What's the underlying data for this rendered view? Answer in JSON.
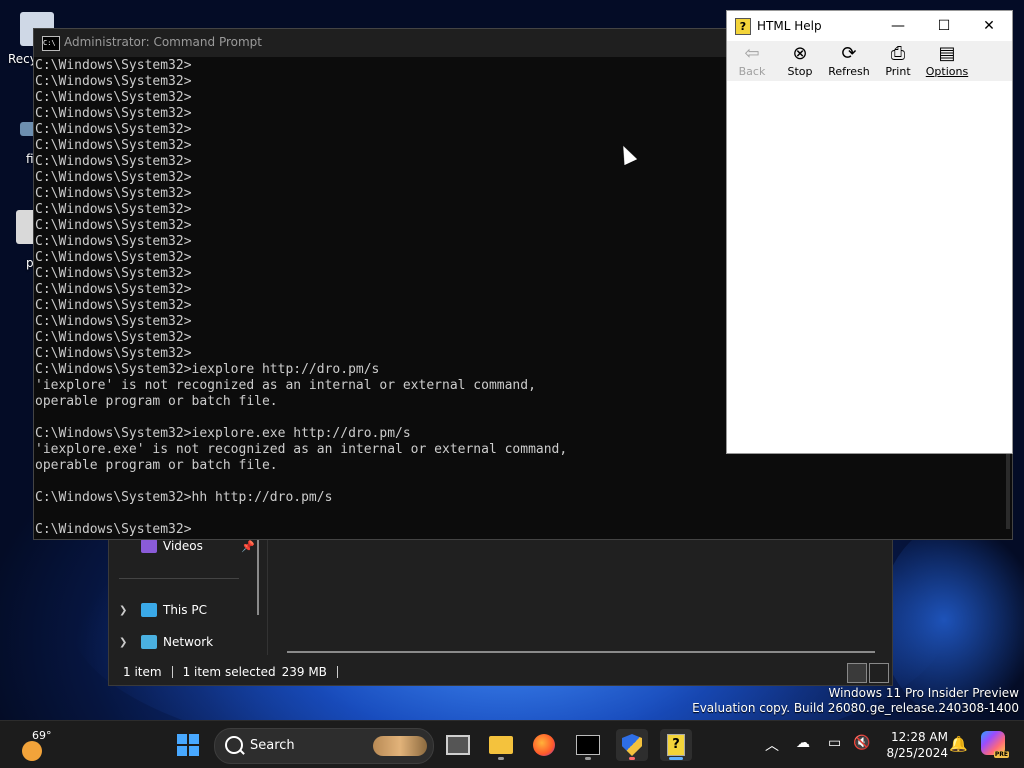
{
  "desktop": {
    "icons": [
      {
        "label": "Recy",
        "color": "#cfd8e6"
      },
      {
        "label": "fi",
        "color": "#6d8fb0"
      },
      {
        "label": "p",
        "color": "#d9d9d9"
      }
    ],
    "watermark_line1": "Windows 11 Pro Insider Preview",
    "watermark_line2": "Evaluation copy. Build 26080.ge_release.240308-1400"
  },
  "explorer": {
    "nav_items": [
      {
        "label": "Videos",
        "icon": "videos-icon",
        "color": "#8a5bd8"
      },
      {
        "label": "This PC",
        "icon": "pc-icon",
        "color": "#3aa9e8"
      },
      {
        "label": "Network",
        "icon": "network-icon",
        "color": "#4ab0e0"
      }
    ],
    "status_items": "1 item",
    "status_selected": "1 item selected",
    "status_size": "239 MB"
  },
  "cmd": {
    "title": "Administrator: Command Prompt",
    "icon_text": "C:\\",
    "lines": [
      "C:\\Windows\\System32>",
      "C:\\Windows\\System32>",
      "C:\\Windows\\System32>",
      "C:\\Windows\\System32>",
      "C:\\Windows\\System32>",
      "C:\\Windows\\System32>",
      "C:\\Windows\\System32>",
      "C:\\Windows\\System32>",
      "C:\\Windows\\System32>",
      "C:\\Windows\\System32>",
      "C:\\Windows\\System32>",
      "C:\\Windows\\System32>",
      "C:\\Windows\\System32>",
      "C:\\Windows\\System32>",
      "C:\\Windows\\System32>",
      "C:\\Windows\\System32>",
      "C:\\Windows\\System32>",
      "C:\\Windows\\System32>",
      "C:\\Windows\\System32>",
      "C:\\Windows\\System32>iexplore http://dro.pm/s",
      "'iexplore' is not recognized as an internal or external command,",
      "operable program or batch file.",
      "",
      "C:\\Windows\\System32>iexplore.exe http://dro.pm/s",
      "'iexplore.exe' is not recognized as an internal or external command,",
      "operable program or batch file.",
      "",
      "C:\\Windows\\System32>hh http://dro.pm/s",
      "",
      "C:\\Windows\\System32>"
    ]
  },
  "help": {
    "title": "HTML Help",
    "icon_text": "?",
    "minimize": "—",
    "maximize": "☐",
    "close": "✕",
    "toolbar": [
      {
        "label": "Back",
        "glyph": "⇦",
        "enabled": false
      },
      {
        "label": "Stop",
        "glyph": "⊗",
        "enabled": true
      },
      {
        "label": "Refresh",
        "glyph": "⟳",
        "enabled": true
      },
      {
        "label": "Print",
        "glyph": "⎙",
        "enabled": true
      },
      {
        "label": "Options",
        "glyph": "▤",
        "enabled": true
      }
    ]
  },
  "taskbar": {
    "weather_temp": "69°",
    "search_label": "Search",
    "time": "12:28 AM",
    "date": "8/25/2024",
    "copilot_badge": "PRE",
    "tray_icons": [
      "chevron-up-icon",
      "cloud-offline-icon",
      "display-icon",
      "volume-muted-icon"
    ]
  },
  "colors": {
    "cmd_text": "#cccccc",
    "accent": "#46a3ff"
  }
}
